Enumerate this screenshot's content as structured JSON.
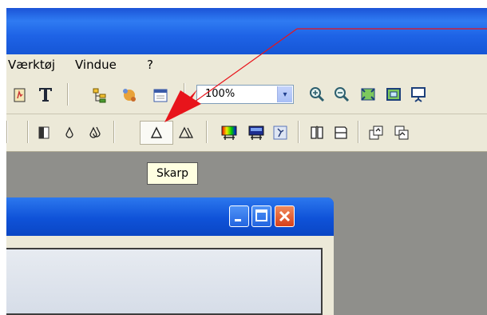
{
  "menu": {
    "items": [
      "Værktøj",
      "Vindue",
      "?"
    ]
  },
  "toolbar": {
    "zoom_value": "100%",
    "zoom_arrow": "▾"
  },
  "tooltip": {
    "text": "Skarp"
  },
  "colors": {
    "titlebar": "#1e63e6",
    "toolbar_bg": "#ece9d8",
    "workspace": "#8f8f8b",
    "annotation_arrow": "#e8141b",
    "close_button": "#e0481e"
  },
  "icons": {
    "toolbar_row1": [
      "document-icon",
      "text-tool-icon",
      "tree-view-icon",
      "puzzle-icon",
      "calendar-icon",
      "zoom-in-icon",
      "zoom-out-icon",
      "fit-window-icon",
      "actual-size-icon",
      "slideshow-icon"
    ],
    "toolbar_row2": [
      "contrast-icon",
      "soften-icon",
      "soften-more-icon",
      "sharpen-icon",
      "sharpen-more-icon",
      "color-balance-icon",
      "monitor-icon",
      "texture-icon",
      "split-view-icon",
      "compare-icon",
      "rotate-icon",
      "flip-icon"
    ]
  }
}
